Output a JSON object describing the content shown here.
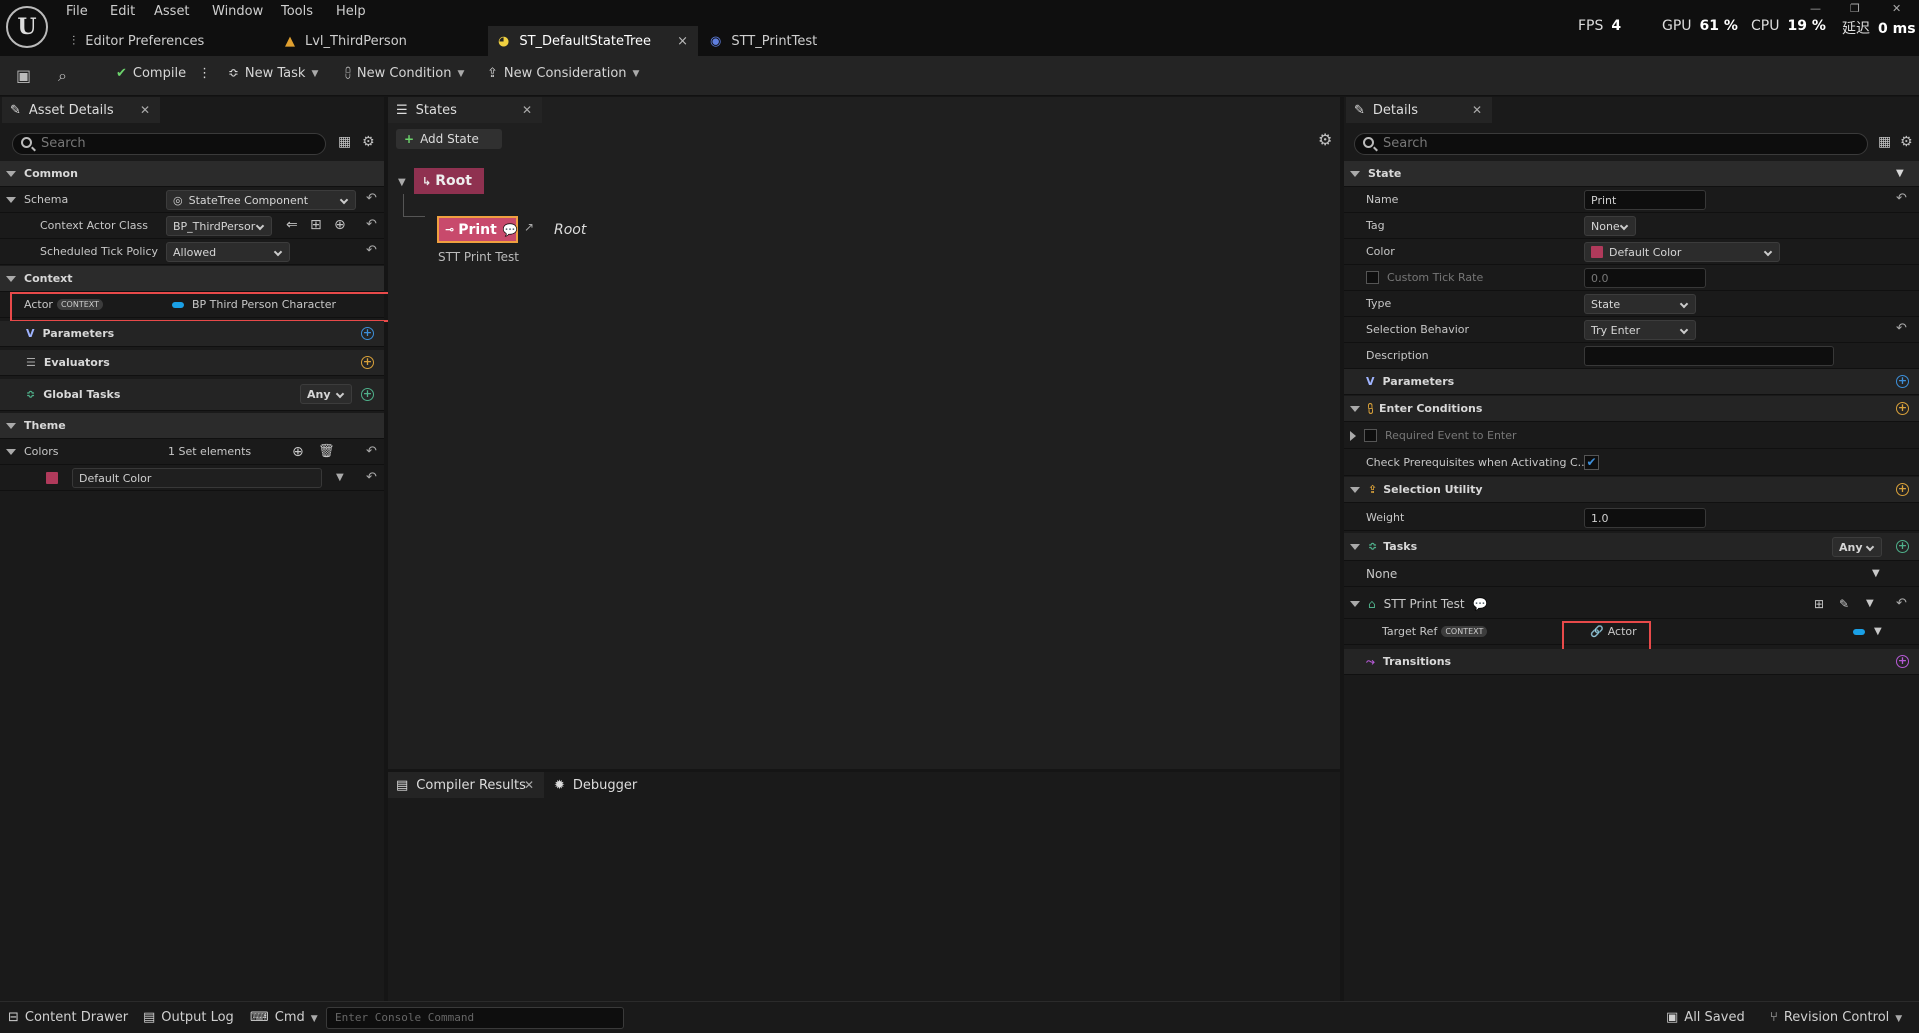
{
  "menu": [
    "File",
    "Edit",
    "Asset",
    "Window",
    "Tools",
    "Help"
  ],
  "tabs": [
    "Editor Preferences",
    "Lvl_ThirdPerson",
    "ST_DefaultStateTree",
    "STT_PrintTest"
  ],
  "tab_close": "×",
  "stats": {
    "fps_label": "FPS",
    "fps": "4",
    "gpu_label": "GPU",
    "gpu": "61 %",
    "cpu_label": "CPU",
    "cpu": "19 %",
    "lat_label": "延迟",
    "lat": "0 ms"
  },
  "toolbar": {
    "compile": "Compile",
    "new_task": "New Task",
    "new_condition": "New Condition",
    "new_consideration": "New Consideration"
  },
  "asset_details": {
    "title": "Asset Details",
    "search": "Search",
    "common": "Common",
    "schema_label": "Schema",
    "schema_value": "StateTree Component",
    "context_actor_label": "Context Actor Class",
    "context_actor_value": "BP_ThirdPersor",
    "tick_label": "Scheduled Tick Policy",
    "tick_value": "Allowed",
    "context": "Context",
    "actor_label": "Actor",
    "actor_badge": "CONTEXT",
    "actor_value": "BP Third Person Character",
    "parameters": "Parameters",
    "evaluators": "Evaluators",
    "global_tasks": "Global Tasks",
    "global_tasks_any": "Any",
    "theme": "Theme",
    "colors_label": "Colors",
    "colors_value": "1 Set elements",
    "color_item": "Default Color"
  },
  "states": {
    "title": "States",
    "add_state": "Add State",
    "root": "Root",
    "print": "Print",
    "print_link": "Root",
    "print_task": "STT Print Test"
  },
  "bottom_tabs": {
    "compiler": "Compiler Results",
    "debugger": "Debugger"
  },
  "details": {
    "title": "Details",
    "search": "Search",
    "state": "State",
    "name_label": "Name",
    "name_value": "Print",
    "tag_label": "Tag",
    "tag_value": "None",
    "color_label": "Color",
    "color_value": "Default Color",
    "tick_rate_label": "Custom Tick Rate",
    "tick_rate_value": "0.0",
    "type_label": "Type",
    "type_value": "State",
    "sel_label": "Selection Behavior",
    "sel_value": "Try Enter",
    "desc_label": "Description",
    "parameters": "Parameters",
    "enter_conditions": "Enter Conditions",
    "req_event": "Required Event to Enter",
    "check_prereq": "Check Prerequisites when Activating C...",
    "selection_utility": "Selection Utility",
    "weight_label": "Weight",
    "weight_value": "1.0",
    "tasks": "Tasks",
    "tasks_any": "Any",
    "tasks_none": "None",
    "task_name": "STT Print Test",
    "target_ref_label": "Target Ref",
    "target_ref_badge": "CONTEXT",
    "target_ref_value": "Actor",
    "transitions": "Transitions"
  },
  "bottombar": {
    "content_drawer": "Content Drawer",
    "output_log": "Output Log",
    "cmd": "Cmd",
    "console_placeholder": "Enter Console Command",
    "all_saved": "All Saved",
    "revision": "Revision Control"
  },
  "colors": {
    "state_root": "#8f3150",
    "state_print": "#c84a6c",
    "highlight": "#e84a4a",
    "accent_blue": "#1aa0e6",
    "plus_green": "#4fb08a",
    "plus_orange": "#d9a13a",
    "plus_blue": "#3d8fd9",
    "plus_purple": "#b65ad6"
  }
}
